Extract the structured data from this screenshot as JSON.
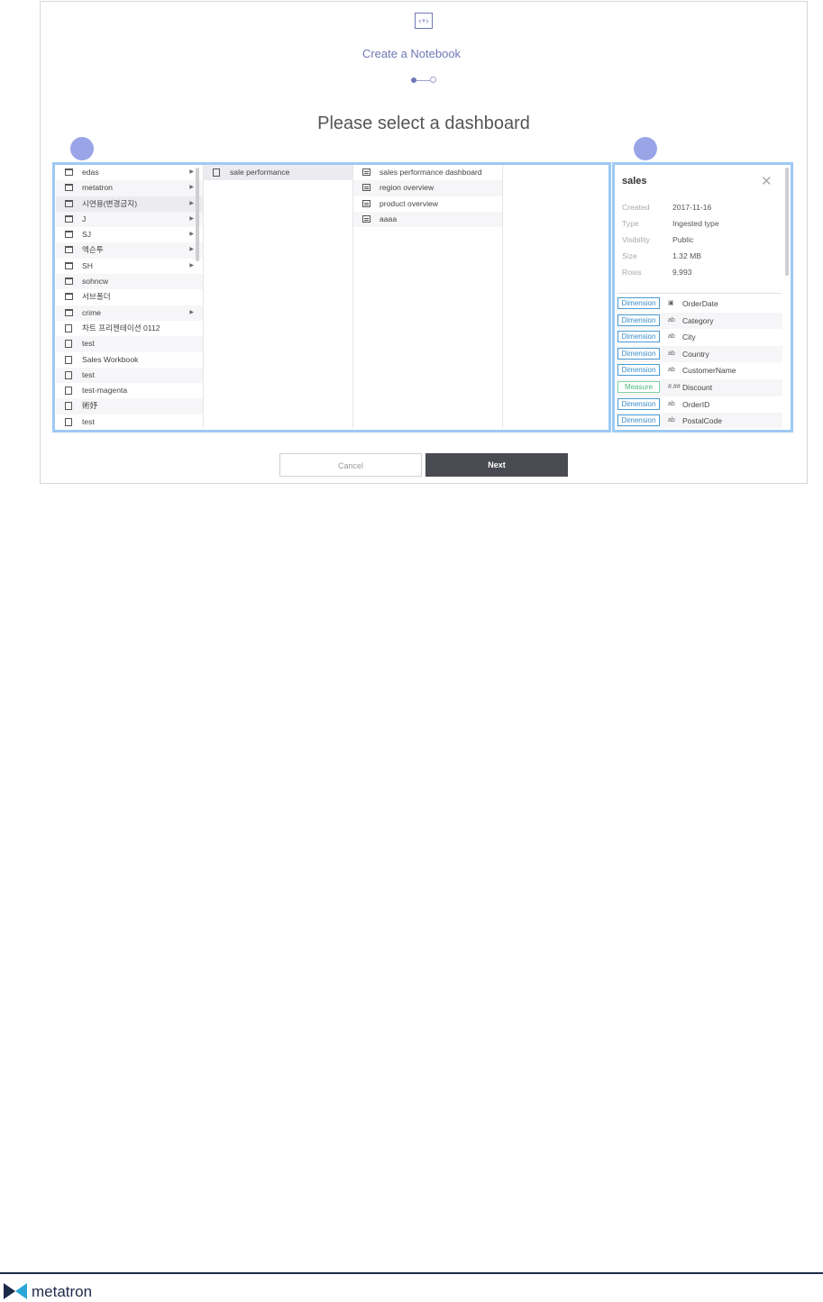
{
  "dialog": {
    "icon_glyph": "‹+›",
    "title": "Create a Notebook",
    "heading": "Please select a dashboard",
    "steps": {
      "current": 1,
      "total": 2
    }
  },
  "workspace_items": [
    {
      "label": "edas",
      "type": "folder",
      "arrow": true
    },
    {
      "label": "metatron",
      "type": "folder",
      "arrow": true
    },
    {
      "label": "시연용(변경금지)",
      "type": "folder",
      "arrow": true,
      "selected": true
    },
    {
      "label": "J",
      "type": "folder",
      "arrow": true
    },
    {
      "label": "SJ",
      "type": "folder",
      "arrow": true
    },
    {
      "label": "엑슨투",
      "type": "folder",
      "arrow": true
    },
    {
      "label": "SH",
      "type": "folder",
      "arrow": true
    },
    {
      "label": "sohncw",
      "type": "folder",
      "arrow": false
    },
    {
      "label": "서브폴더",
      "type": "folder",
      "arrow": false
    },
    {
      "label": "crime",
      "type": "folder",
      "arrow": true
    },
    {
      "label": "차트 프리젠테이션 0112",
      "type": "book",
      "arrow": false
    },
    {
      "label": "test",
      "type": "book",
      "arrow": false
    },
    {
      "label": "Sales Workbook",
      "type": "book",
      "arrow": false
    },
    {
      "label": "test",
      "type": "book",
      "arrow": false
    },
    {
      "label": "test-magenta",
      "type": "book",
      "arrow": false
    },
    {
      "label": "術妤",
      "type": "book",
      "arrow": false
    },
    {
      "label": "test",
      "type": "book",
      "arrow": false
    }
  ],
  "workbooks": [
    {
      "label": "sale performance",
      "type": "book",
      "selected": true
    }
  ],
  "dashboards": [
    {
      "label": "sales performance dashboard",
      "type": "dash"
    },
    {
      "label": "region overview",
      "type": "dash"
    },
    {
      "label": "product overview",
      "type": "dash"
    },
    {
      "label": "aaaa",
      "type": "dash"
    }
  ],
  "datasource": {
    "name": "sales",
    "close_glyph": "✕",
    "meta": [
      {
        "key": "Created",
        "value": "2017-11-16"
      },
      {
        "key": "Type",
        "value": "Ingested type"
      },
      {
        "key": "Visibility",
        "value": "Public"
      },
      {
        "key": "Size",
        "value": "1.32 MB"
      },
      {
        "key": "Rows",
        "value": "9,993"
      }
    ],
    "fields": [
      {
        "role": "Dimension",
        "type_glyph": "▣",
        "name": "OrderDate"
      },
      {
        "role": "Dimension",
        "type_glyph": "ab",
        "name": "Category"
      },
      {
        "role": "Dimension",
        "type_glyph": "ab",
        "name": "City"
      },
      {
        "role": "Dimension",
        "type_glyph": "ab",
        "name": "Country"
      },
      {
        "role": "Dimension",
        "type_glyph": "ab",
        "name": "CustomerName"
      },
      {
        "role": "Measure",
        "type_glyph": "#.##",
        "name": "Discount"
      },
      {
        "role": "Dimension",
        "type_glyph": "ab",
        "name": "OrderID"
      },
      {
        "role": "Dimension",
        "type_glyph": "ab",
        "name": "PostalCode"
      }
    ]
  },
  "buttons": {
    "cancel": "Cancel",
    "next": "Next"
  },
  "footer": {
    "brand": "metatron"
  },
  "colors": {
    "accent": "#6f78b5",
    "primary_button": "#4a4b52",
    "highlight_outline": "#9ec9f4",
    "dimension": "#3a8ccb",
    "measure": "#4cb97e"
  }
}
